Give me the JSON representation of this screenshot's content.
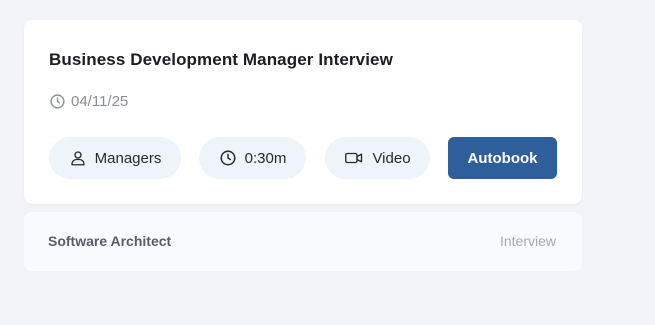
{
  "main_card": {
    "title": "Business Development Manager Interview",
    "date": "04/11/25",
    "pills": {
      "audience": {
        "icon": "user-icon",
        "label": "Managers"
      },
      "duration": {
        "icon": "clock-icon",
        "label": "0:30m"
      },
      "format": {
        "icon": "video-camera-icon",
        "label": "Video"
      }
    },
    "action": {
      "label": "Autobook"
    }
  },
  "list_items": [
    {
      "title": "Software Architect",
      "type": "Interview"
    }
  ],
  "colors": {
    "page_background": "#f2f3f9",
    "card_background": "#ffffff",
    "pill_background": "#eff3fa",
    "primary_button": "#2f5f9b",
    "title_text": "#1a1d24",
    "muted_text": "#8b8f98"
  }
}
